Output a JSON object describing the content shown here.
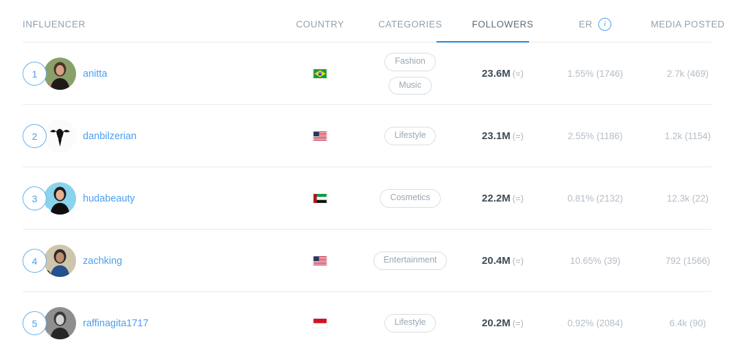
{
  "header": {
    "columns": [
      {
        "key": "influencer",
        "label": "INFLUENCER",
        "active": false
      },
      {
        "key": "country",
        "label": "COUNTRY",
        "active": false
      },
      {
        "key": "categories",
        "label": "CATEGORIES",
        "active": false
      },
      {
        "key": "followers",
        "label": "FOLLOWERS",
        "active": true
      },
      {
        "key": "er",
        "label": "ER",
        "active": false
      },
      {
        "key": "media",
        "label": "MEDIA POSTED",
        "active": false
      }
    ],
    "info_icon": "info-icon",
    "info_glyph": "i",
    "sort_active_column": "FOLLOWERS"
  },
  "colors": {
    "accent": "#1a86e0",
    "link": "#4a9ff0",
    "header_text": "#90a0ad",
    "muted": "#b4bdc6",
    "rule": "#e8eaec",
    "value": "#3d4a57"
  },
  "rows": [
    {
      "rank": "1",
      "handle": "anitta",
      "country_code": "BR",
      "country_name": "Brazil",
      "categories": [
        "Fashion",
        "Music"
      ],
      "followers": "23.6M",
      "followers_delta": "(=)",
      "er": "1.55% (1746)",
      "media_posted": "2.7k (469)"
    },
    {
      "rank": "2",
      "handle": "danbilzerian",
      "country_code": "US",
      "country_name": "United States",
      "categories": [
        "Lifestyle"
      ],
      "followers": "23.1M",
      "followers_delta": "(=)",
      "er": "2.55% (1186)",
      "media_posted": "1.2k (1154)"
    },
    {
      "rank": "3",
      "handle": "hudabeauty",
      "country_code": "AE",
      "country_name": "United Arab Emirates",
      "categories": [
        "Cosmetics"
      ],
      "followers": "22.2M",
      "followers_delta": "(=)",
      "er": "0.81% (2132)",
      "media_posted": "12.3k (22)"
    },
    {
      "rank": "4",
      "handle": "zachking",
      "country_code": "US",
      "country_name": "United States",
      "categories": [
        "Entertainment"
      ],
      "followers": "20.4M",
      "followers_delta": "(=)",
      "er": "10.65% (39)",
      "media_posted": "792 (1566)"
    },
    {
      "rank": "5",
      "handle": "raffinagita1717",
      "country_code": "ID",
      "country_name": "Indonesia",
      "categories": [
        "Lifestyle"
      ],
      "followers": "20.2M",
      "followers_delta": "(=)",
      "er": "0.92% (2084)",
      "media_posted": "6.4k (90)"
    }
  ]
}
